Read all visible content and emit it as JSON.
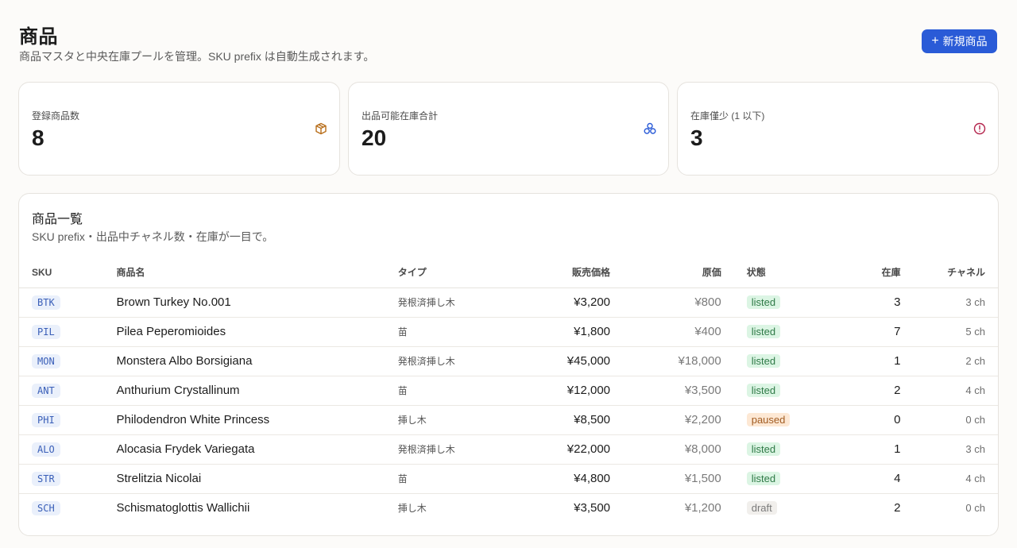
{
  "header": {
    "title": "商品",
    "subtitle": "商品マスタと中央在庫プールを管理。SKU prefix は自動生成されます。",
    "new_button_label": "新規商品"
  },
  "stats": [
    {
      "label": "登録商品数",
      "value": "8",
      "icon": "package-icon",
      "color": "#b86e1a"
    },
    {
      "label": "出品可能在庫合計",
      "value": "20",
      "icon": "boxes-icon",
      "color": "#2a5bd7"
    },
    {
      "label": "在庫僅少 (1 以下)",
      "value": "3",
      "icon": "alert-circle-icon",
      "color": "#b3234b"
    }
  ],
  "list": {
    "title": "商品一覧",
    "subtitle": "SKU prefix・出品中チャネル数・在庫が一目で。",
    "columns": {
      "sku": "SKU",
      "name": "商品名",
      "type": "タイプ",
      "price": "販売価格",
      "cost": "原価",
      "status": "状態",
      "stock": "在庫",
      "channels": "チャネル"
    },
    "rows": [
      {
        "sku": "BTK",
        "name": "Brown Turkey No.001",
        "type": "発根済挿し木",
        "price": "¥3,200",
        "cost": "¥800",
        "status": "listed",
        "stock": "3",
        "channels": "3 ch"
      },
      {
        "sku": "PIL",
        "name": "Pilea Peperomioides",
        "type": "苗",
        "price": "¥1,800",
        "cost": "¥400",
        "status": "listed",
        "stock": "7",
        "channels": "5 ch"
      },
      {
        "sku": "MON",
        "name": "Monstera Albo Borsigiana",
        "type": "発根済挿し木",
        "price": "¥45,000",
        "cost": "¥18,000",
        "status": "listed",
        "stock": "1",
        "channels": "2 ch"
      },
      {
        "sku": "ANT",
        "name": "Anthurium Crystallinum",
        "type": "苗",
        "price": "¥12,000",
        "cost": "¥3,500",
        "status": "listed",
        "stock": "2",
        "channels": "4 ch"
      },
      {
        "sku": "PHI",
        "name": "Philodendron White Princess",
        "type": "挿し木",
        "price": "¥8,500",
        "cost": "¥2,200",
        "status": "paused",
        "stock": "0",
        "channels": "0 ch"
      },
      {
        "sku": "ALO",
        "name": "Alocasia Frydek Variegata",
        "type": "発根済挿し木",
        "price": "¥22,000",
        "cost": "¥8,000",
        "status": "listed",
        "stock": "1",
        "channels": "3 ch"
      },
      {
        "sku": "STR",
        "name": "Strelitzia Nicolai",
        "type": "苗",
        "price": "¥4,800",
        "cost": "¥1,500",
        "status": "listed",
        "stock": "4",
        "channels": "4 ch"
      },
      {
        "sku": "SCH",
        "name": "Schismatoglottis Wallichii",
        "type": "挿し木",
        "price": "¥3,500",
        "cost": "¥1,200",
        "status": "draft",
        "stock": "2",
        "channels": "0 ch"
      }
    ]
  }
}
